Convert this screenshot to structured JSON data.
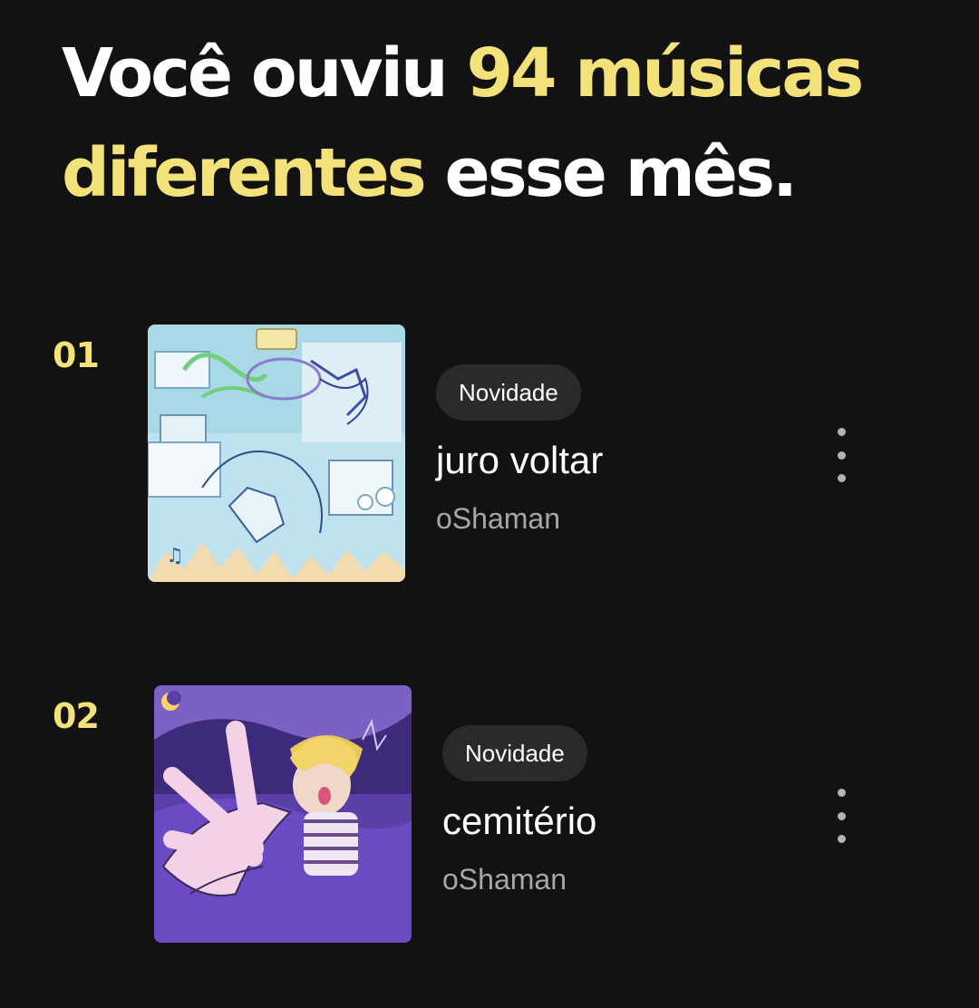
{
  "headline": {
    "part1": "Você ouviu ",
    "highlight": "94 músicas diferentes",
    "part2": " esse mês."
  },
  "colors": {
    "background": "#121212",
    "accent": "#f3e27a",
    "badge_bg": "#2a2a2a",
    "secondary_text": "#a7a7a7"
  },
  "tracks": [
    {
      "rank": "01",
      "badge": "Novidade",
      "title": "juro voltar",
      "artist": "oShaman",
      "menu_icon": "more-vertical-icon"
    },
    {
      "rank": "02",
      "badge": "Novidade",
      "title": "cemitério",
      "artist": "oShaman",
      "menu_icon": "more-vertical-icon"
    }
  ]
}
